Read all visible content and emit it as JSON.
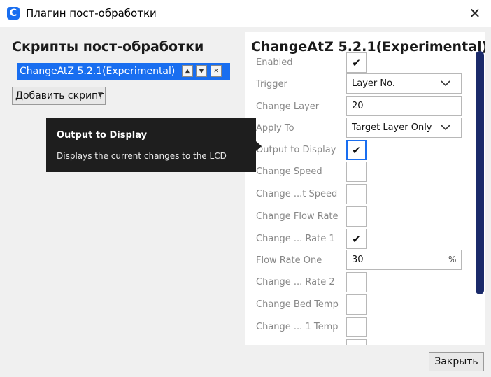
{
  "window": {
    "title": "Плагин пост-обработки",
    "app_icon": "C",
    "close_glyph": "✕"
  },
  "left": {
    "heading": "Скрипты пост-обработки",
    "script_item": {
      "label": "ChangeAtZ 5.2.1(Experimental)",
      "up": "▲",
      "down": "▼",
      "remove": "✕"
    },
    "add_button": {
      "label": "Добавить скрипт",
      "arrow": "▼"
    }
  },
  "tooltip": {
    "title": "Output to Display",
    "text": "Displays the current changes to the LCD"
  },
  "panel": {
    "title": "ChangeAtZ 5.2.1(Experimental)",
    "check_glyph": "✔",
    "rows": [
      {
        "label": "Enabled",
        "checked": true
      },
      {
        "label": "Trigger",
        "value": "Layer No."
      },
      {
        "label": "Change Layer",
        "value": "20"
      },
      {
        "label": "Apply To",
        "value": "Target Layer Only"
      },
      {
        "label": "Output to Display",
        "checked": true
      },
      {
        "label": "Change Speed",
        "checked": false
      },
      {
        "label": "Change ...t Speed",
        "checked": false
      },
      {
        "label": "Change Flow Rate",
        "checked": false
      },
      {
        "label": "Change ... Rate 1",
        "checked": true
      },
      {
        "label": "Flow Rate One",
        "value": "30",
        "unit": "%"
      },
      {
        "label": "Change ... Rate 2",
        "checked": false
      },
      {
        "label": "Change Bed Temp",
        "checked": false
      },
      {
        "label": "Change ... 1 Temp",
        "checked": false
      }
    ]
  },
  "footer": {
    "close_label": "Закрыть"
  },
  "colors": {
    "accent": "#196ef0",
    "scrollbar": "#1a2a6a",
    "tooltip_bg": "#1e1e1e"
  }
}
